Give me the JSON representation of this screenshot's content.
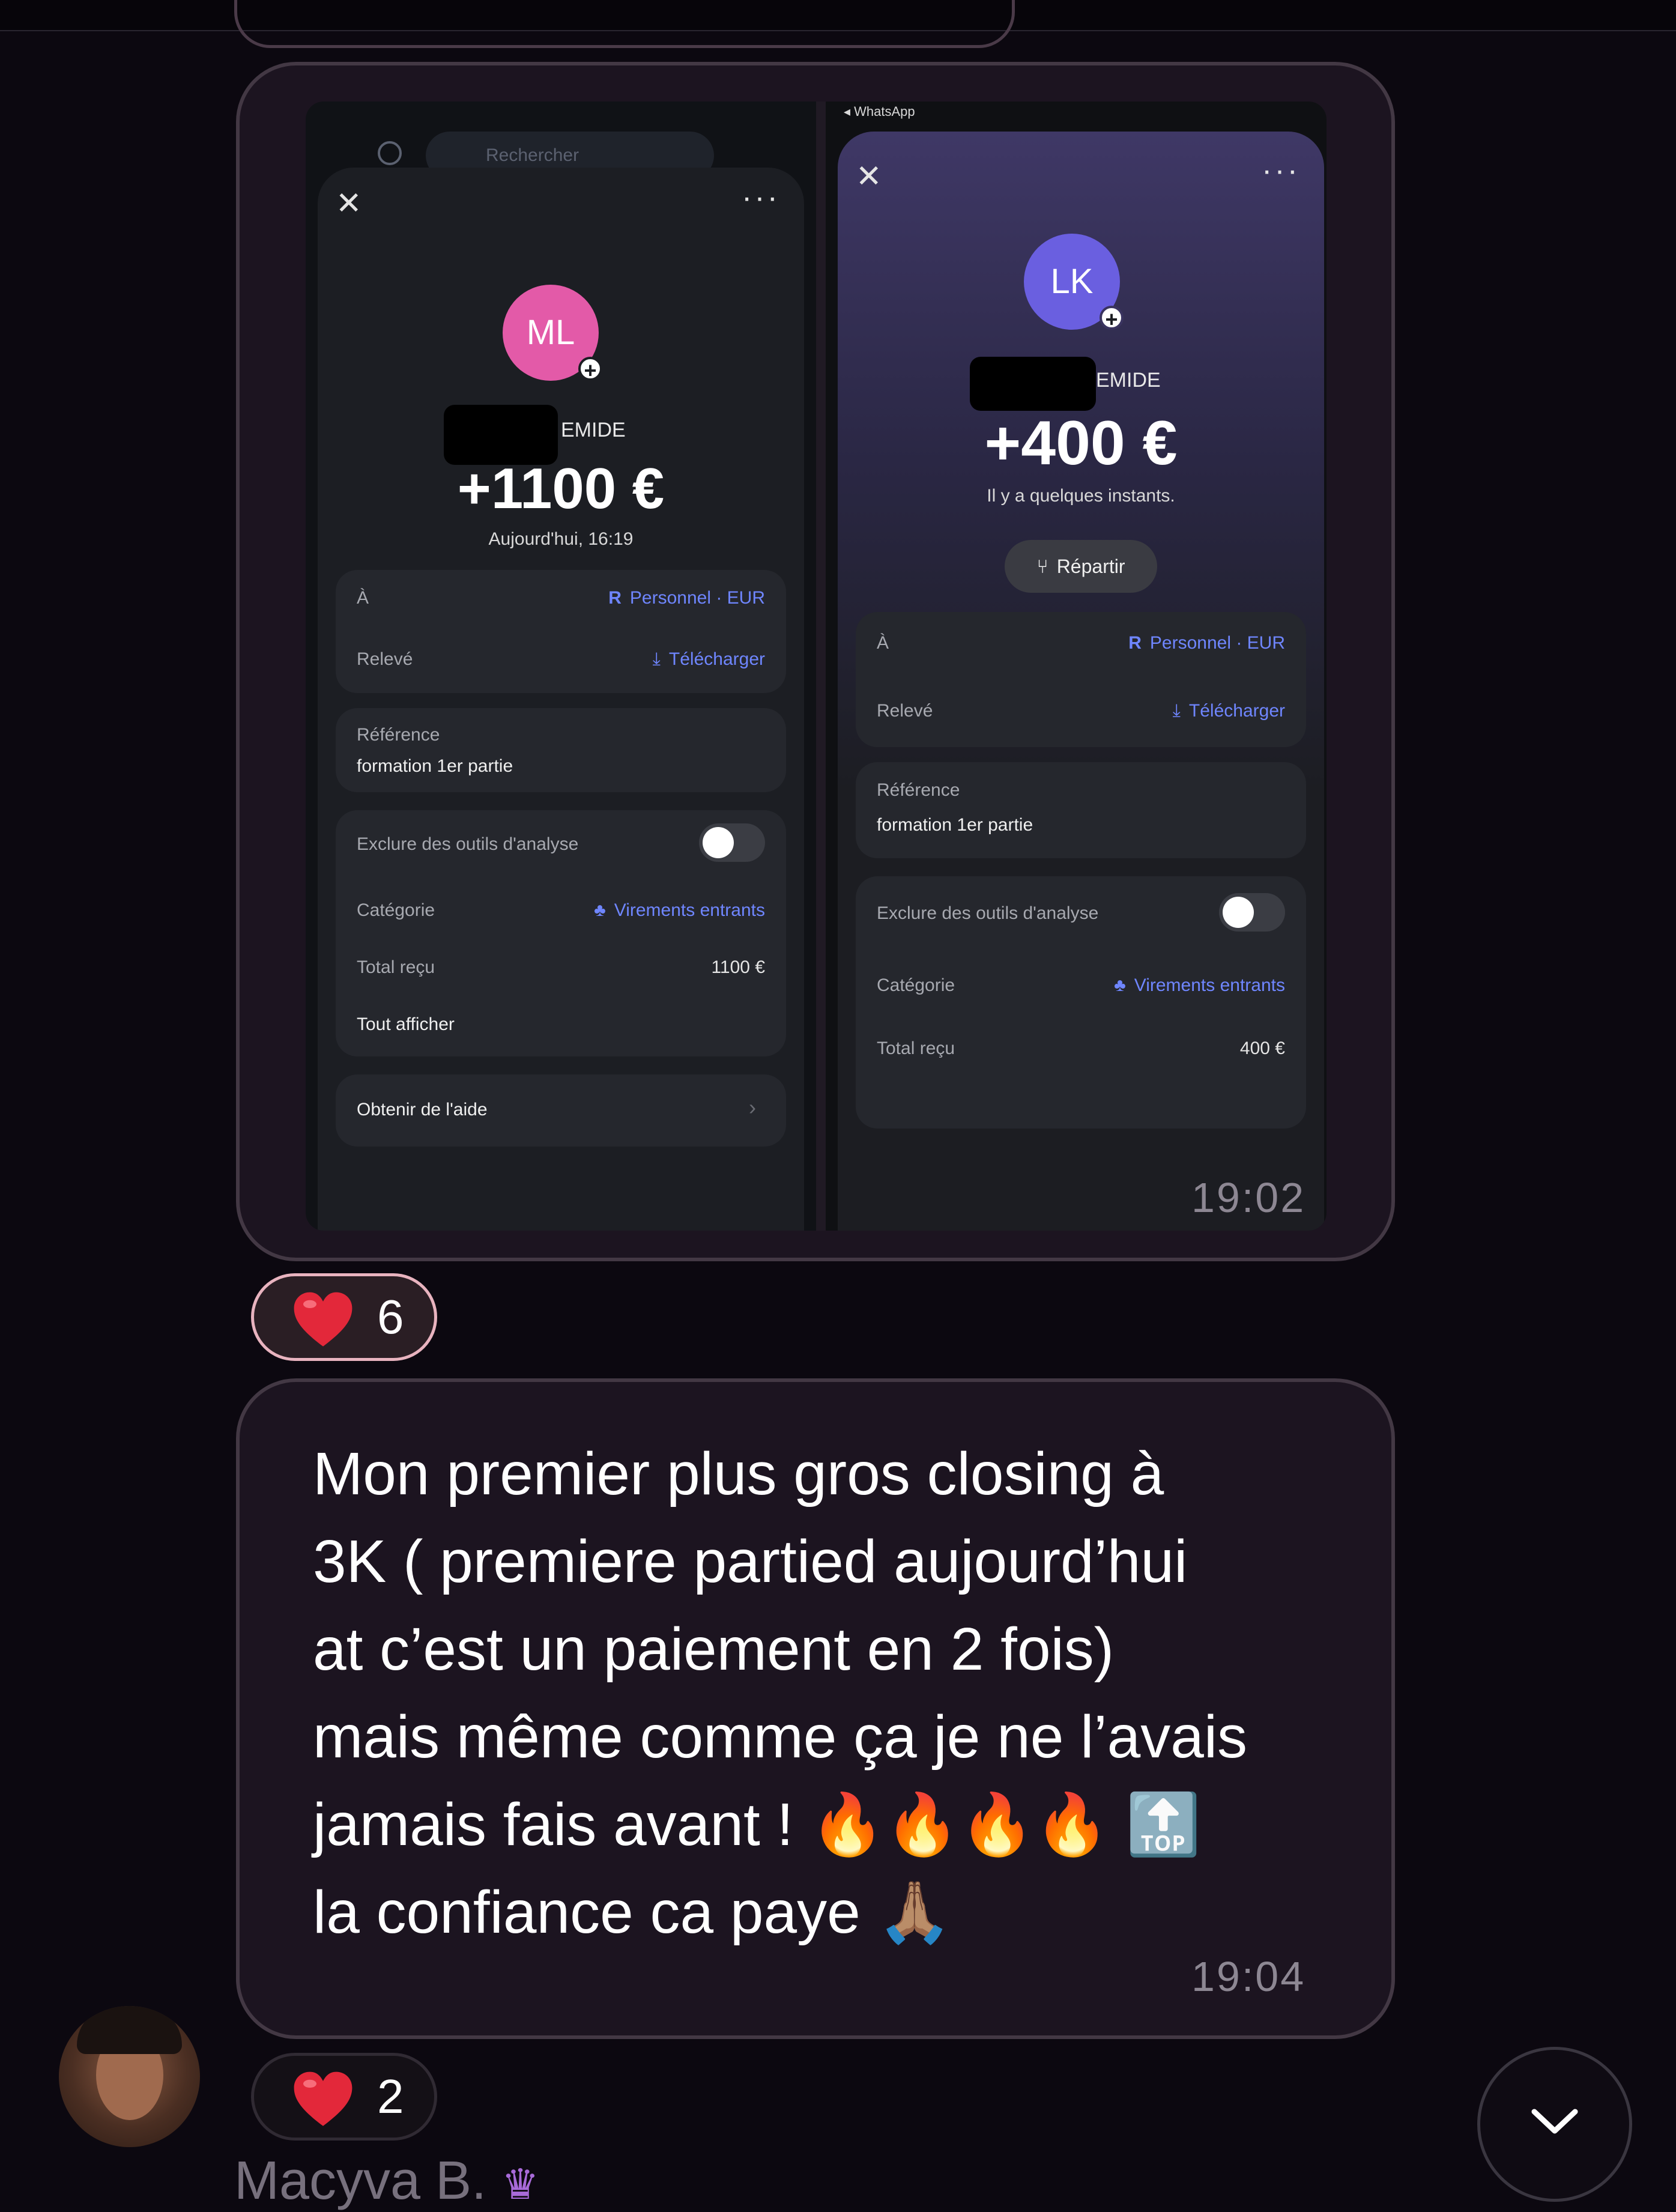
{
  "chat": {
    "image_message": {
      "time": "19:02",
      "left_screenshot": {
        "search_placeholder": "Rechercher",
        "avatar_initials": "ML",
        "name_suffix": "EMIDE",
        "amount": "+1100 €",
        "date": "Aujourd'hui, 16:19",
        "to_label": "À",
        "to_value": "Personnel · EUR",
        "statement_label": "Relevé",
        "statement_action": "Télécharger",
        "reference_label": "Référence",
        "reference_value": "formation 1er partie",
        "exclude_label": "Exclure des outils d'analyse",
        "category_label": "Catégorie",
        "category_value": "Virements entrants",
        "total_label": "Total reçu",
        "total_value": "1100 €",
        "show_all": "Tout afficher",
        "help": "Obtenir de l'aide"
      },
      "right_screenshot": {
        "status_app": "◂ WhatsApp",
        "avatar_initials": "LK",
        "name_suffix": "EMIDE",
        "amount": "+400 €",
        "date": "Il y a quelques instants.",
        "split_button": "Répartir",
        "to_label": "À",
        "to_value": "Personnel · EUR",
        "statement_label": "Relevé",
        "statement_action": "Télécharger",
        "reference_label": "Référence",
        "reference_value": "formation 1er partie",
        "exclude_label": "Exclure des outils d'analyse",
        "category_label": "Catégorie",
        "category_value": "Virements entrants",
        "total_label": "Total reçu",
        "total_value": "400 €"
      },
      "reaction": {
        "emoji": "heart",
        "count": "6"
      }
    },
    "text_message": {
      "text": "Mon premier plus gros closing à\n3K ( premiere partied aujourd’hui\nat c’est un paiement en 2 fois)\nmais même comme ça je ne l’avais\njamais fais avant ! 🔥🔥🔥🔥 🔝\nla confiance ca paye 🙏🏽",
      "time": "19:04",
      "reaction": {
        "emoji": "heart",
        "count": "2"
      }
    },
    "next_sender_name": "Macyva B."
  },
  "colors": {
    "background": "#0c0810",
    "bubble": "#1c1420",
    "bubble_border": "#433844",
    "accent_blue": "#6f86ff",
    "avatar_ml": "#e35aa8",
    "avatar_lk": "#6a5fe0",
    "heart": "#e3283a"
  },
  "icons": [
    "search-icon",
    "close-icon",
    "more-icon",
    "download-icon",
    "category-icon",
    "split-icon",
    "chevron-right-icon",
    "heart-icon",
    "chevron-down-icon"
  ]
}
